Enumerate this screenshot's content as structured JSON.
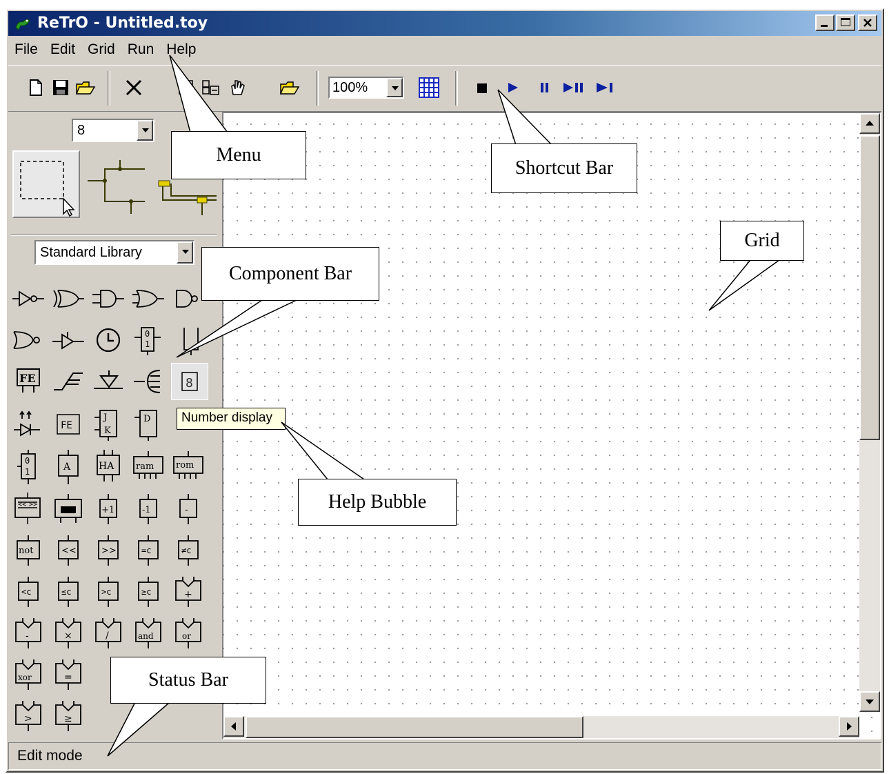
{
  "window": {
    "title": "ReTrO - Untitled.toy"
  },
  "menu": {
    "items": [
      "File",
      "Edit",
      "Grid",
      "Run",
      "Help"
    ]
  },
  "toolbar": {
    "zoom_value": "100%",
    "icons": [
      "new-file",
      "save",
      "open",
      "delete",
      "copy",
      "paste",
      "clear",
      "open-folder",
      "zoom",
      "grid-toggle",
      "stop",
      "play",
      "pause",
      "play-pause",
      "step"
    ]
  },
  "left_panel": {
    "net_size_value": "8",
    "library_value": "Standard Library"
  },
  "components": {
    "texts": {
      "FE": "FE",
      "num": "8",
      "J": "J",
      "K": "K",
      "D": "D",
      "A": "A",
      "HA": "HA",
      "ram": "ram",
      "rom": "rom",
      "plus1": "+1",
      "minus1": "-1",
      "minus": "-",
      "not": "not",
      "shl": "<<",
      "shr": ">>",
      "eqc": "=c",
      "neqc": "≠c",
      "ltc": "<c",
      "lec": "≤c",
      "gtc": ">c",
      "gec": "≥c",
      "plus": "+",
      "sub": "-",
      "mul": "×",
      "div": "/",
      "and": "and",
      "or": "or",
      "xor": "xor",
      "eq": "=",
      "gt": ">",
      "ge": "≥",
      "zero": "0",
      "one": "1"
    }
  },
  "tooltip": {
    "text": "Number display"
  },
  "statusbar": {
    "text": "Edit mode"
  },
  "callouts": {
    "menu": "Menu",
    "shortcut_bar": "Shortcut Bar",
    "grid": "Grid",
    "component_bar": "Component Bar",
    "help_bubble": "Help Bubble",
    "status_bar": "Status Bar"
  },
  "colors": {
    "title_gradient_start": "#0a246a",
    "title_gradient_end": "#a6caf0",
    "window_face": "#d4d0c8",
    "tooltip_bg": "#ffffe1",
    "run_controls": "#0a1fa0"
  }
}
